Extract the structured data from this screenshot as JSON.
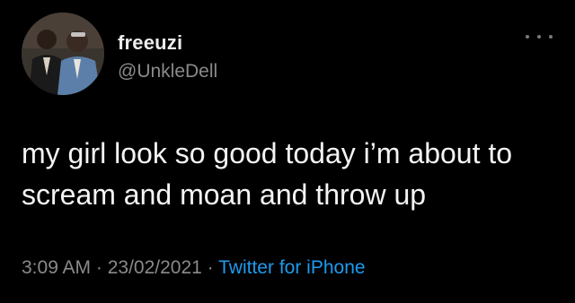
{
  "tweet": {
    "display_name": "freeuzi",
    "handle": "@UnkleDell",
    "more_icon": "more-horizontal-icon",
    "text": "my girl look so good today i’m about to scream and moan and throw up",
    "time": "3:09 AM",
    "separator": " · ",
    "date": "23/02/2021",
    "source": "Twitter for iPhone"
  },
  "colors": {
    "background": "#000000",
    "text": "#f4f4f4",
    "secondary": "#8a8a8a",
    "link": "#1d9bf0"
  }
}
